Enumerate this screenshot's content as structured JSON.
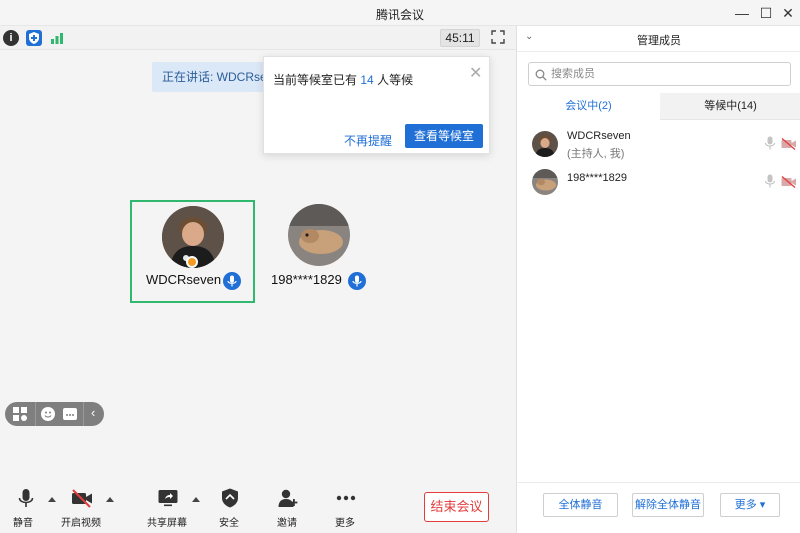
{
  "window": {
    "title": "腾讯会议"
  },
  "status": {
    "timer": "45:11"
  },
  "speaking": {
    "text": "正在讲话: WDCRseven"
  },
  "popup": {
    "message_prefix": "当前等候室已有",
    "waiting_count": "14",
    "message_suffix": "人等候",
    "dismiss_label": "不再提醒",
    "view_label": "查看等候室"
  },
  "participants": [
    {
      "name": "WDCRseven"
    },
    {
      "name": "198****1829"
    }
  ],
  "toolbar": {
    "mute_label": "静音",
    "video_label": "开启视频",
    "share_label": "共享屏幕",
    "security_label": "安全",
    "invite_label": "邀请",
    "more_label": "更多",
    "end_label": "结束会议"
  },
  "panel": {
    "title": "管理成员",
    "search_placeholder": "搜索成员",
    "tab_in_meeting": "会议中(2)",
    "tab_waiting": "等候中(14)",
    "members": [
      {
        "name": "WDCRseven",
        "role": "(主持人, 我)"
      },
      {
        "name": "198****1829",
        "role": ""
      }
    ],
    "mute_all_label": "全体静音",
    "unmute_all_label": "解除全体静音",
    "more_label": "更多 ▾"
  },
  "colors": {
    "accent": "#1f6fd6",
    "danger": "#e23c3c",
    "active_speaker": "#2fb86e"
  }
}
